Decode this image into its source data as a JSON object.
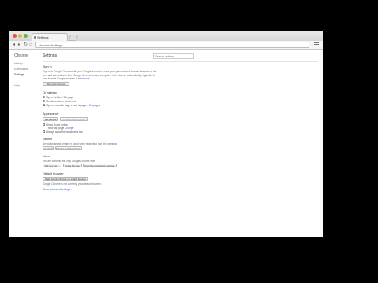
{
  "tab": {
    "title": "Settings"
  },
  "toolbar": {
    "url": "chrome://settings"
  },
  "sidebar": {
    "brand": "Chrome",
    "items": [
      {
        "label": "History"
      },
      {
        "label": "Extensions"
      },
      {
        "label": "Settings"
      },
      {
        "label": "Help"
      }
    ]
  },
  "main": {
    "title": "Settings",
    "search_placeholder": "Search settings"
  },
  "sign_in": {
    "heading": "Sign in",
    "line1": "Sign in to Google Chrome with your Google Account to save your personalized browser features to the",
    "line2": "web and access them from Google Chrome on any computer. You'll also be automatically signed in to",
    "line3": "your favorite Google services.",
    "learn_more": "Learn more",
    "button": "Sign in to Chrome"
  },
  "on_startup": {
    "heading": "On startup",
    "options": [
      {
        "label": "Open the New Tab page",
        "selected": false
      },
      {
        "label": "Continue where you left off",
        "selected": false
      },
      {
        "label": "Open a specific page or set of pages.",
        "link": "Set pages",
        "selected": true
      }
    ]
  },
  "appearance": {
    "heading": "Appearance",
    "get_themes": "Get themes",
    "reset_theme": "Reset to default theme",
    "show_home": "Show Home button",
    "new_tab_page": "New Tab page",
    "change": "Change",
    "bookmarks_bar": "Always show the bookmarks bar"
  },
  "search": {
    "heading": "Search",
    "line": "Set which search engine is used when searching from the",
    "omnibox": "omnibox",
    "engine": "Google",
    "manage": "Manage search engines..."
  },
  "users": {
    "heading": "Users",
    "line": "You are currently the only Google Chrome user.",
    "add": "Add new user...",
    "delete": "Delete this user",
    "import": "Import bookmarks and settings..."
  },
  "default_browser": {
    "heading": "Default browser",
    "button": "Make Google Chrome my default browser",
    "line": "Google Chrome is not currently your default browser."
  },
  "advanced": "Show advanced settings..."
}
